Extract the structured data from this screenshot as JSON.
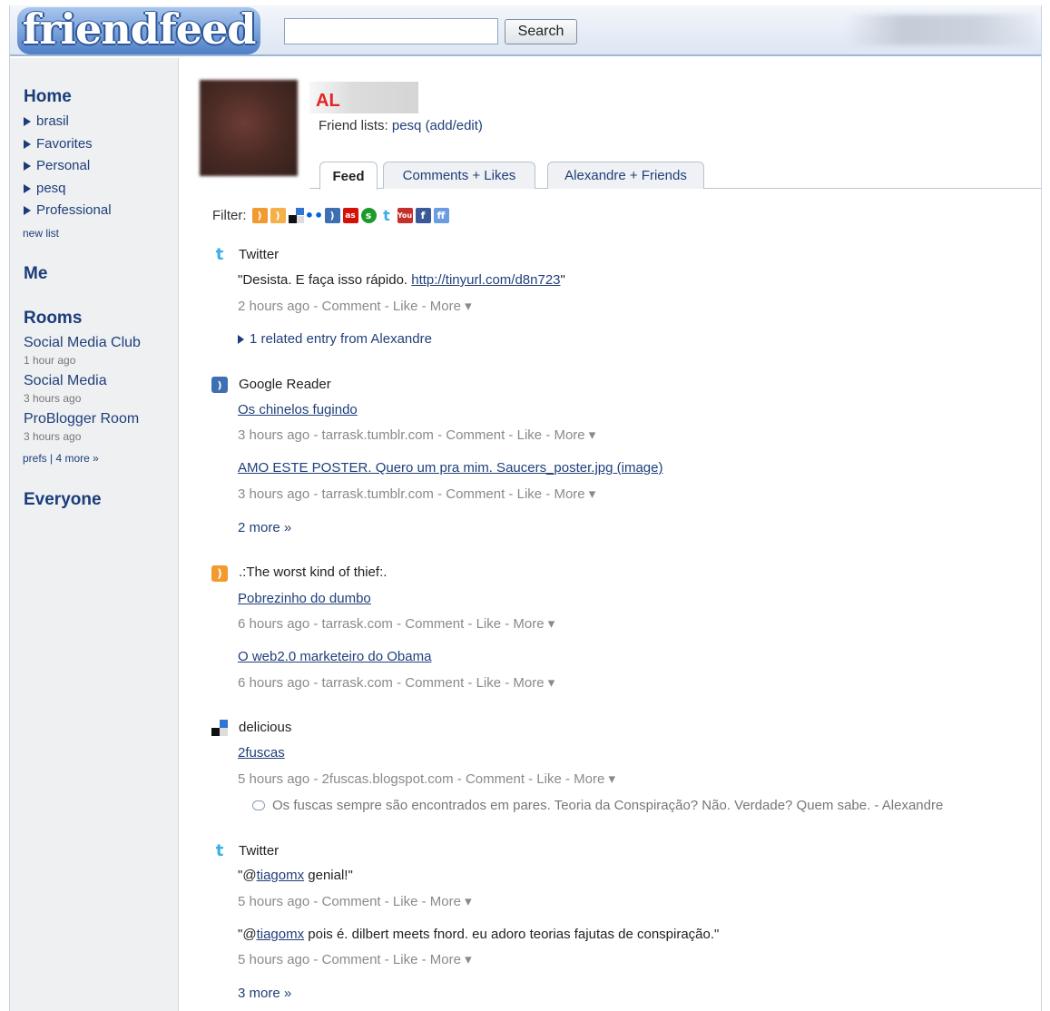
{
  "header": {
    "logo_text": "friendfeed",
    "search_value": "",
    "search_button": "Search"
  },
  "sidebar": {
    "home": "Home",
    "lists": [
      "brasil",
      "Favorites",
      "Personal",
      "pesq",
      "Professional"
    ],
    "new_list": "new list",
    "me": "Me",
    "rooms_title": "Rooms",
    "rooms": [
      {
        "name": "Social Media Club",
        "time": "1 hour ago"
      },
      {
        "name": "Social Media",
        "time": "3 hours ago"
      },
      {
        "name": "ProBlogger Room",
        "time": "3 hours ago"
      }
    ],
    "prefs": "prefs | 4 more »",
    "everyone": "Everyone"
  },
  "profile": {
    "name": "AL",
    "friend_lists_label": "Friend lists:",
    "friend_list": "pesq",
    "add_edit": "(add/edit)"
  },
  "tabs": [
    {
      "label": "Feed",
      "active": true
    },
    {
      "label": "Comments + Likes",
      "active": false
    },
    {
      "label": "Alexandre + Friends",
      "active": false
    }
  ],
  "filter_label": "Filter:",
  "filter_icons": [
    "blog-rss-icon",
    "rss-icon",
    "delicious-icon",
    "flickr-icon",
    "google-reader-icon",
    "lastfm-icon",
    "stumbleupon-icon",
    "twitter-icon",
    "youtube-icon",
    "facebook-icon",
    "friendfeed-icon"
  ],
  "feed": {
    "twitter1": {
      "source": "Twitter",
      "text_prefix": "\"Desista. E faça isso rápido. ",
      "link": "http://tinyurl.com/d8n723",
      "text_suffix": "\"",
      "meta": "2 hours ago - Comment - Like - More ▾",
      "related": "1 related entry from Alexandre"
    },
    "greader": {
      "source": "Google Reader",
      "item1_title": "Os chinelos fugindo",
      "item1_meta": "3 hours ago - tarrask.tumblr.com - Comment - Like - More ▾",
      "item2_title": "AMO ESTE POSTER. Quero um pra mim. Saucers_poster.jpg (image)",
      "item2_meta": "3 hours ago - tarrask.tumblr.com - Comment - Like - More ▾",
      "more": "2 more »"
    },
    "blog": {
      "source": ".:The worst kind of thief:.",
      "item1_title": "Pobrezinho do dumbo",
      "item1_meta": "6 hours ago - tarrask.com - Comment - Like - More ▾",
      "item2_title": "O web2.0 marketeiro do Obama",
      "item2_meta": "6 hours ago - tarrask.com - Comment - Like - More ▾"
    },
    "delicious": {
      "source": "delicious",
      "item_title": "2fuscas",
      "item_meta": "5 hours ago - 2fuscas.blogspot.com - Comment - Like - More ▾",
      "comment": "Os fuscas sempre são encontrados em pares. Teoria da Conspiração? Não. Verdade? Quem sabe. - Alexandre"
    },
    "twitter2": {
      "source": "Twitter",
      "item1_open": "\"@",
      "item1_user": "tiagomx",
      "item1_rest": " genial!\"",
      "item1_meta": "5 hours ago - Comment - Like - More ▾",
      "item2_open": "\"@",
      "item2_user": "tiagomx",
      "item2_rest": " pois é. dilbert meets fnord. eu adoro teorias fajutas de conspiração.\"",
      "item2_meta": "5 hours ago - Comment - Like - More ▾",
      "more": "3 more »"
    }
  }
}
